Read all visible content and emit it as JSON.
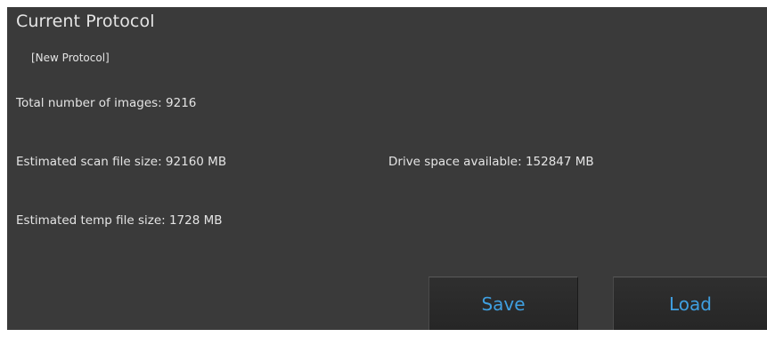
{
  "panel": {
    "title": "Current Protocol",
    "protocol_name": "[New Protocol]"
  },
  "info": {
    "total_images": "Total number of images: 9216",
    "scan_file_size": "Estimated scan file size: 92160 MB",
    "drive_space": "Drive space available: 152847 MB",
    "temp_file_size": "Estimated temp file size: 1728 MB"
  },
  "buttons": {
    "save_label": "Save",
    "load_label": "Load"
  },
  "colors": {
    "panel_background": "#3a3a3a",
    "text": "#e4e4e4",
    "button_text": "#3f9fe0",
    "button_background": "#2a2a2a"
  }
}
